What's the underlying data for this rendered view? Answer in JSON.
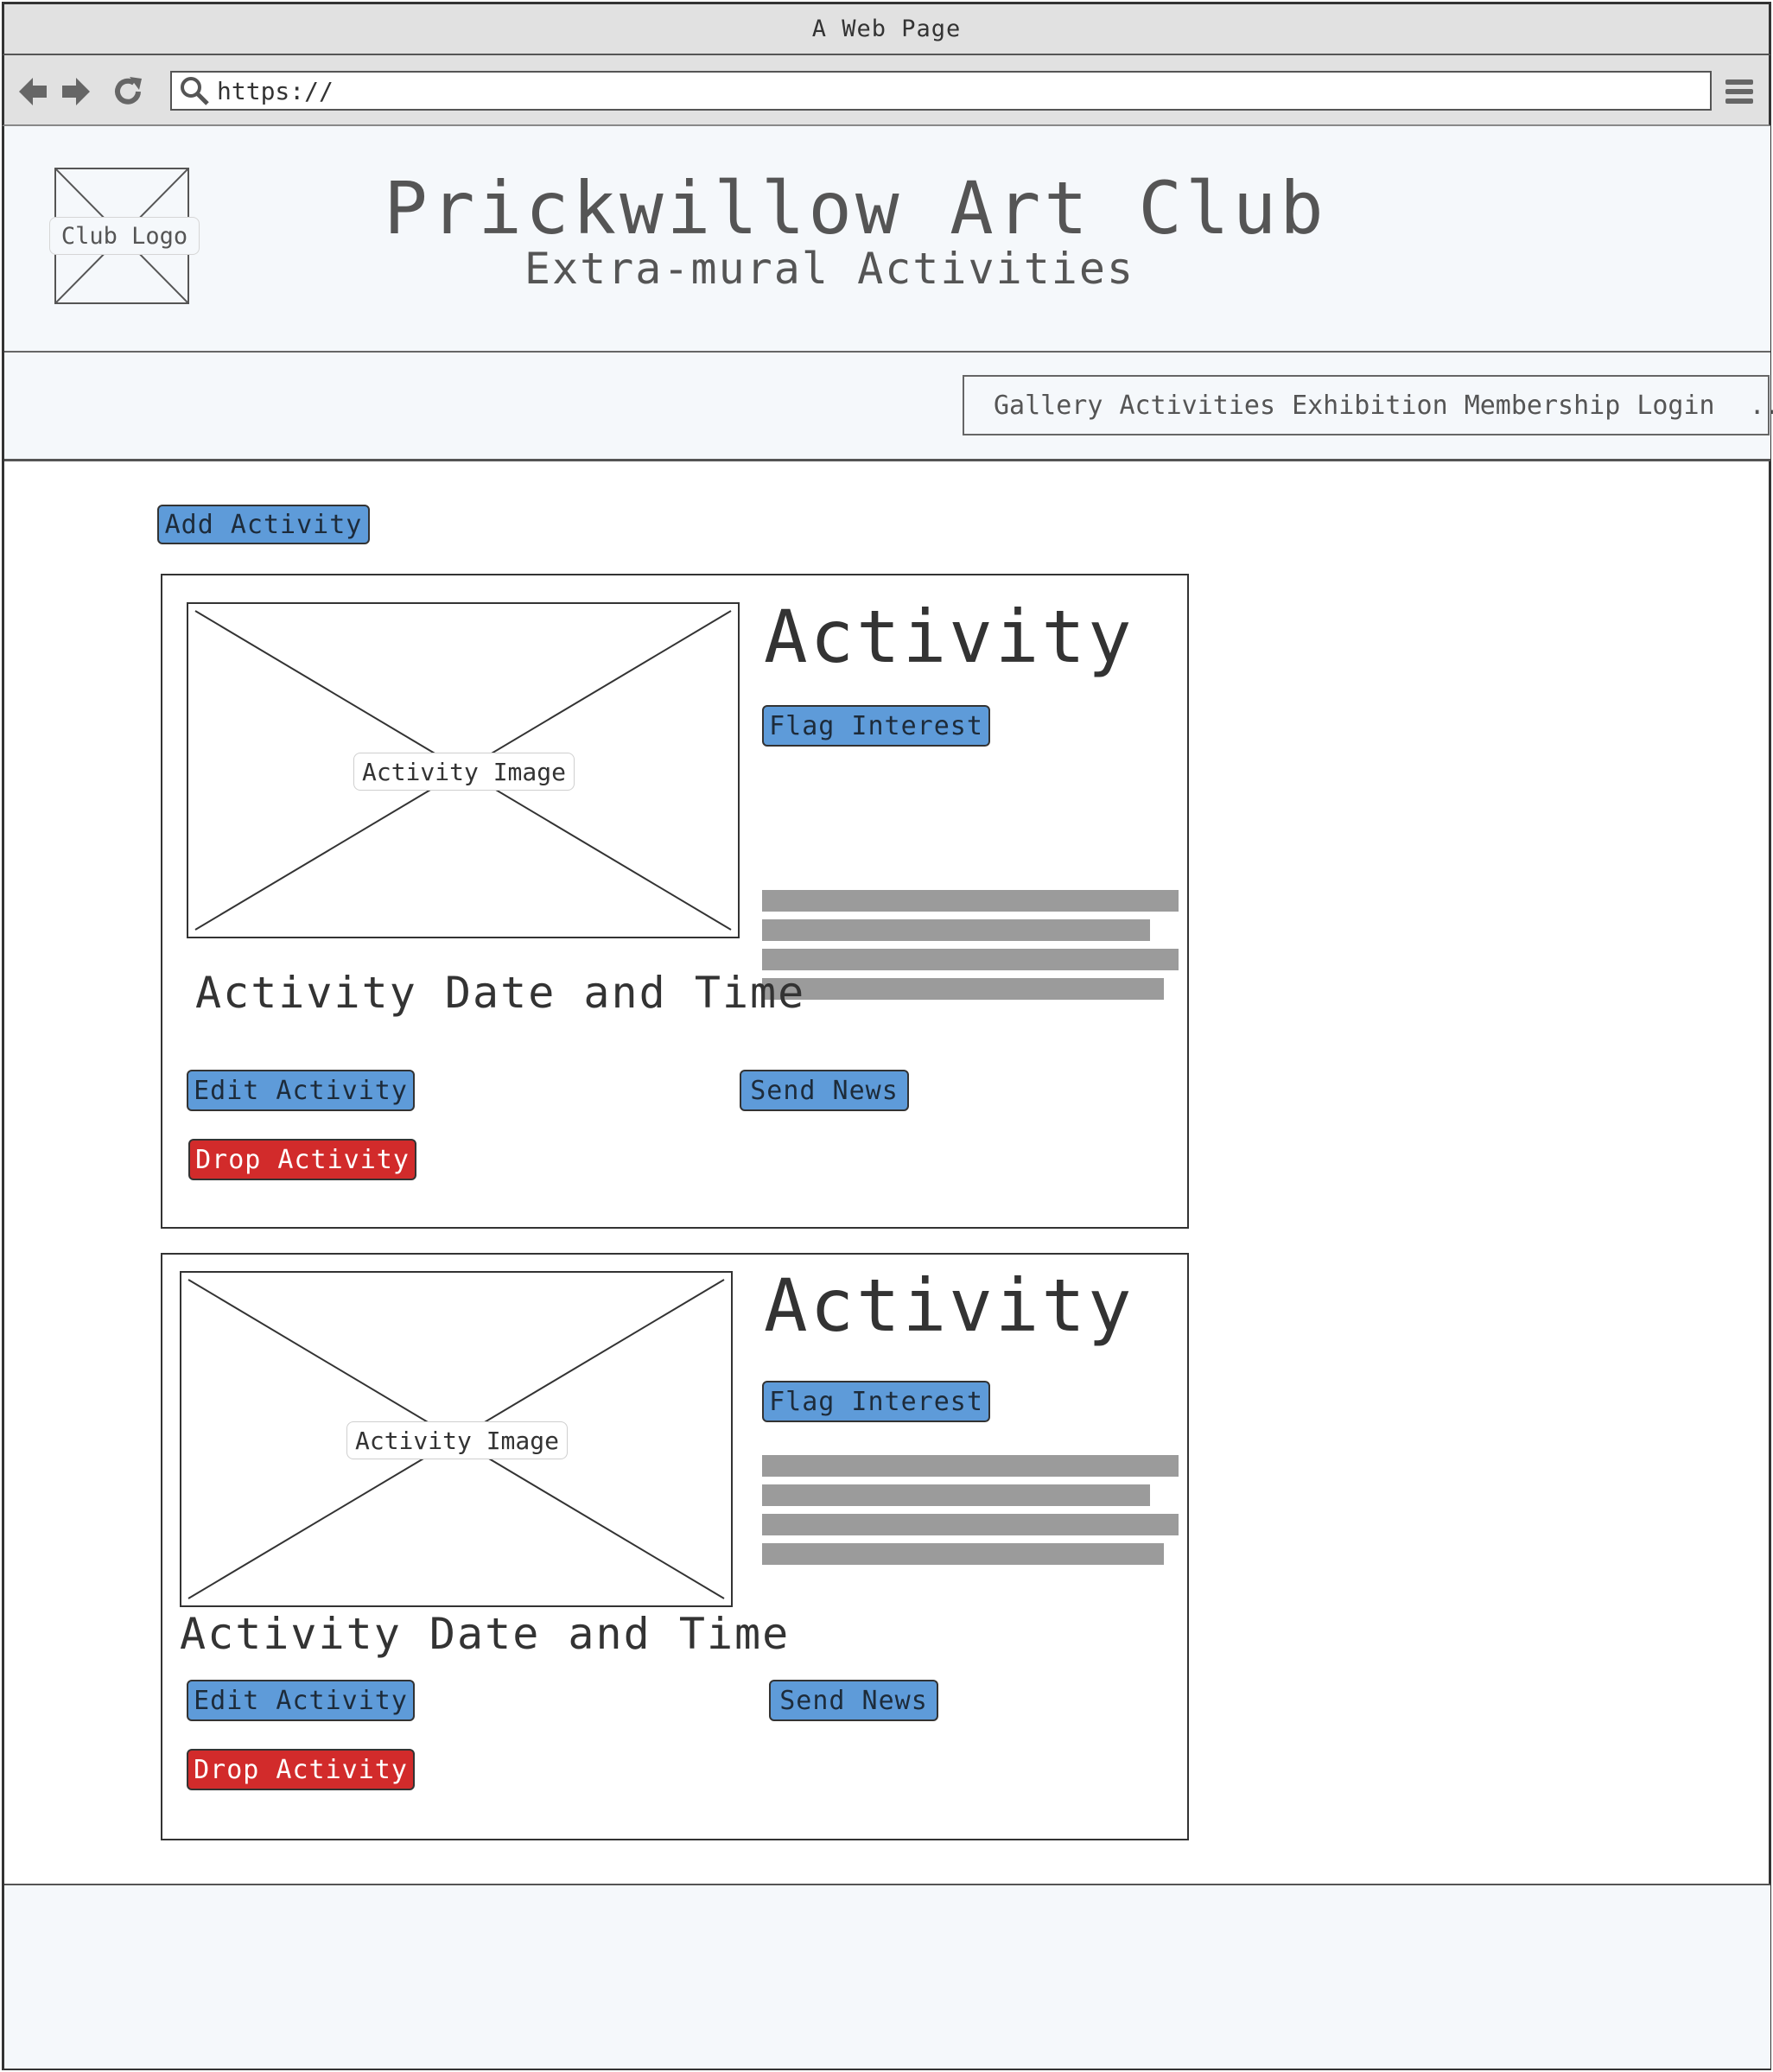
{
  "browser": {
    "window_title": "A Web Page",
    "url": "https://"
  },
  "header": {
    "logo_label": "Club Logo",
    "title": "Prickwillow Art Club",
    "subtitle": "Extra-mural Activities"
  },
  "nav": {
    "items": [
      "Gallery",
      "Activities",
      "Exhibition",
      "Membership",
      "Login"
    ],
    "more": "..."
  },
  "toolbar": {
    "add_label": "Add Activity"
  },
  "activities": [
    {
      "image_label": "Activity Image",
      "title": "Activity",
      "date": "Activity Date and Time",
      "flag_label": "Flag Interest",
      "edit_label": "Edit Activity",
      "send_label": "Send News",
      "drop_label": "Drop Activity"
    },
    {
      "image_label": "Activity Image",
      "title": "Activity",
      "date": "Activity Date and Time",
      "flag_label": "Flag Interest",
      "edit_label": "Edit Activity",
      "send_label": "Send News",
      "drop_label": "Drop Activity"
    }
  ],
  "colors": {
    "primary_button": "#5e9bd9",
    "danger_button": "#d22b2b",
    "panel_background": "#f5f8fb",
    "text_placeholder": "#9b9b9b"
  }
}
